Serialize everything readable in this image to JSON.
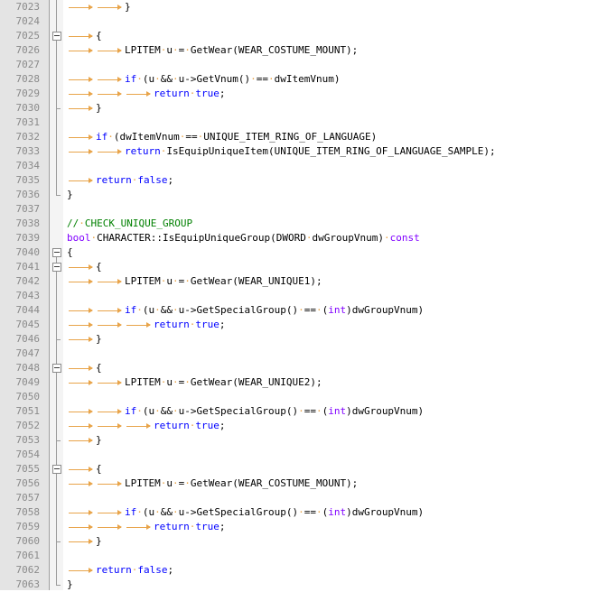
{
  "editor": {
    "colors": {
      "keyword": "#0000ff",
      "type": "#8000ff",
      "comment": "#008000",
      "whitespace_marker": "#e8a44a",
      "line_number": "#8a8a8a",
      "gutter_bg": "#e4e4e4"
    },
    "whitespace_symbols": {
      "tab": "tab-arrow",
      "space": "·"
    },
    "lines": [
      {
        "no": "7023",
        "fold": "line",
        "code": [
          {
            "tab": 2
          },
          {
            "t": "}"
          }
        ]
      },
      {
        "no": "7024",
        "fold": "line",
        "code": []
      },
      {
        "no": "7025",
        "fold": "box",
        "code": [
          {
            "tab": 1
          },
          {
            "t": "{"
          }
        ]
      },
      {
        "no": "7026",
        "fold": "line",
        "code": [
          {
            "tab": 2
          },
          {
            "t": "LPITEM u = GetWear(WEAR_COSTUME_MOUNT);"
          }
        ]
      },
      {
        "no": "7027",
        "fold": "line",
        "code": []
      },
      {
        "no": "7028",
        "fold": "line",
        "code": [
          {
            "tab": 2
          },
          {
            "k": "if"
          },
          {
            "t": " (u && u->GetVnum() == dwItemVnum)"
          }
        ]
      },
      {
        "no": "7029",
        "fold": "line",
        "code": [
          {
            "tab": 3
          },
          {
            "k": "return"
          },
          {
            "t": " "
          },
          {
            "k": "true"
          },
          {
            "t": ";"
          }
        ]
      },
      {
        "no": "7030",
        "fold": "end",
        "code": [
          {
            "tab": 1
          },
          {
            "t": "}"
          }
        ]
      },
      {
        "no": "7031",
        "fold": "line",
        "code": []
      },
      {
        "no": "7032",
        "fold": "line",
        "code": [
          {
            "tab": 1
          },
          {
            "k": "if"
          },
          {
            "t": " (dwItemVnum == UNIQUE_ITEM_RING_OF_LANGUAGE)"
          }
        ]
      },
      {
        "no": "7033",
        "fold": "line",
        "code": [
          {
            "tab": 2
          },
          {
            "k": "return"
          },
          {
            "t": " IsEquipUniqueItem(UNIQUE_ITEM_RING_OF_LANGUAGE_SAMPLE);"
          }
        ]
      },
      {
        "no": "7034",
        "fold": "line",
        "code": []
      },
      {
        "no": "7035",
        "fold": "line",
        "code": [
          {
            "tab": 1
          },
          {
            "k": "return"
          },
          {
            "t": " "
          },
          {
            "k": "false"
          },
          {
            "t": ";"
          }
        ]
      },
      {
        "no": "7036",
        "fold": "end",
        "code": [
          {
            "t": "}"
          }
        ]
      },
      {
        "no": "7037",
        "fold": "none",
        "code": []
      },
      {
        "no": "7038",
        "fold": "none",
        "code": [
          {
            "c": "// CHECK_UNIQUE_GROUP"
          }
        ]
      },
      {
        "no": "7039",
        "fold": "none",
        "code": [
          {
            "y": "bool"
          },
          {
            "t": " CHARACTER::IsEquipUniqueGroup(DWORD dwGroupVnum) "
          },
          {
            "y": "const"
          }
        ]
      },
      {
        "no": "7040",
        "fold": "box",
        "code": [
          {
            "t": "{"
          }
        ]
      },
      {
        "no": "7041",
        "fold": "box",
        "code": [
          {
            "tab": 1
          },
          {
            "t": "{"
          }
        ]
      },
      {
        "no": "7042",
        "fold": "line",
        "code": [
          {
            "tab": 2
          },
          {
            "t": "LPITEM u = GetWear(WEAR_UNIQUE1);"
          }
        ]
      },
      {
        "no": "7043",
        "fold": "line",
        "code": []
      },
      {
        "no": "7044",
        "fold": "line",
        "code": [
          {
            "tab": 2
          },
          {
            "k": "if"
          },
          {
            "t": " (u && u->GetSpecialGroup() == ("
          },
          {
            "y": "int"
          },
          {
            "t": ")dwGroupVnum)"
          }
        ]
      },
      {
        "no": "7045",
        "fold": "line",
        "code": [
          {
            "tab": 3
          },
          {
            "k": "return"
          },
          {
            "t": " "
          },
          {
            "k": "true"
          },
          {
            "t": ";"
          }
        ]
      },
      {
        "no": "7046",
        "fold": "end",
        "code": [
          {
            "tab": 1
          },
          {
            "t": "}"
          }
        ]
      },
      {
        "no": "7047",
        "fold": "line",
        "code": []
      },
      {
        "no": "7048",
        "fold": "box",
        "code": [
          {
            "tab": 1
          },
          {
            "t": "{"
          }
        ]
      },
      {
        "no": "7049",
        "fold": "line",
        "code": [
          {
            "tab": 2
          },
          {
            "t": "LPITEM u = GetWear(WEAR_UNIQUE2);"
          }
        ]
      },
      {
        "no": "7050",
        "fold": "line",
        "code": []
      },
      {
        "no": "7051",
        "fold": "line",
        "code": [
          {
            "tab": 2
          },
          {
            "k": "if"
          },
          {
            "t": " (u && u->GetSpecialGroup() == ("
          },
          {
            "y": "int"
          },
          {
            "t": ")dwGroupVnum)"
          }
        ]
      },
      {
        "no": "7052",
        "fold": "line",
        "code": [
          {
            "tab": 3
          },
          {
            "k": "return"
          },
          {
            "t": " "
          },
          {
            "k": "true"
          },
          {
            "t": ";"
          }
        ]
      },
      {
        "no": "7053",
        "fold": "end",
        "code": [
          {
            "tab": 1
          },
          {
            "t": "}"
          }
        ]
      },
      {
        "no": "7054",
        "fold": "line",
        "code": []
      },
      {
        "no": "7055",
        "fold": "box",
        "code": [
          {
            "tab": 1
          },
          {
            "t": "{"
          }
        ]
      },
      {
        "no": "7056",
        "fold": "line",
        "code": [
          {
            "tab": 2
          },
          {
            "t": "LPITEM u = GetWear(WEAR_COSTUME_MOUNT);"
          }
        ]
      },
      {
        "no": "7057",
        "fold": "line",
        "code": []
      },
      {
        "no": "7058",
        "fold": "line",
        "code": [
          {
            "tab": 2
          },
          {
            "k": "if"
          },
          {
            "t": " (u && u->GetSpecialGroup() == ("
          },
          {
            "y": "int"
          },
          {
            "t": ")dwGroupVnum)"
          }
        ]
      },
      {
        "no": "7059",
        "fold": "line",
        "code": [
          {
            "tab": 3
          },
          {
            "k": "return"
          },
          {
            "t": " "
          },
          {
            "k": "true"
          },
          {
            "t": ";"
          }
        ]
      },
      {
        "no": "7060",
        "fold": "end",
        "code": [
          {
            "tab": 1
          },
          {
            "t": "}"
          }
        ]
      },
      {
        "no": "7061",
        "fold": "line",
        "code": []
      },
      {
        "no": "7062",
        "fold": "line",
        "code": [
          {
            "tab": 1
          },
          {
            "k": "return"
          },
          {
            "t": " "
          },
          {
            "k": "false"
          },
          {
            "t": ";"
          }
        ]
      },
      {
        "no": "7063",
        "fold": "end",
        "code": [
          {
            "t": "}"
          }
        ]
      }
    ]
  }
}
